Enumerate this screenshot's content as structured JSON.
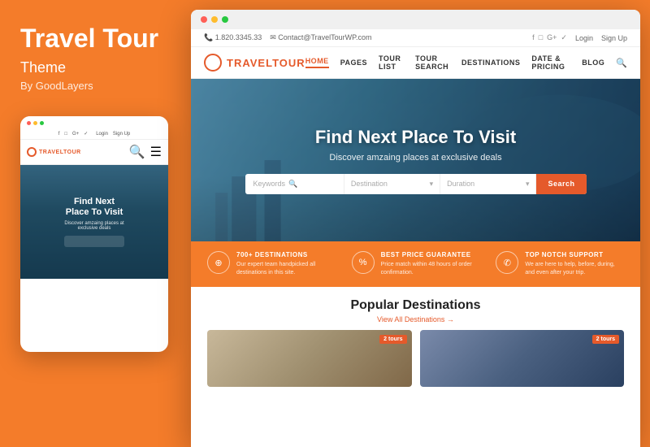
{
  "left": {
    "title": "Travel\nTour",
    "subtitle": "Theme",
    "by": "By GoodLayers"
  },
  "mobile": {
    "dots": [
      "red",
      "yellow",
      "green"
    ],
    "topLinks": [
      "f",
      "□",
      "G+",
      "✓"
    ],
    "loginLabel": "Login",
    "signUpLabel": "Sign Up",
    "logoText": "TRAVEL",
    "logoSpan": "TOUR",
    "heroTitle": "Find Next\nPlace To Visit",
    "heroSubtitle": "Discover amzaing places at\nexclusive deals"
  },
  "desktop": {
    "chromeDots": [
      "red",
      "yellow",
      "green"
    ],
    "topbar": {
      "phone": "📞 1.820.3345.33",
      "email": "✉ Contact@TravelTourWP.com",
      "social": [
        "f",
        "□",
        "G+",
        "✓"
      ],
      "login": "Login",
      "signup": "Sign Up"
    },
    "nav": {
      "logoText": "TRAVEL",
      "logoSpan": "TOUR",
      "menuItems": [
        "HOME",
        "PAGES",
        "TOUR LIST",
        "TOUR SEARCH",
        "DESTINATIONS",
        "DATE & PRICING",
        "BLOG"
      ]
    },
    "hero": {
      "title": "Find Next Place To Visit",
      "subtitle": "Discover amzaing places at exclusive deals",
      "search": {
        "keywordsPlaceholder": "Keywords",
        "destinationPlaceholder": "Destination",
        "durationPlaceholder": "Duration",
        "buttonLabel": "Search"
      }
    },
    "features": [
      {
        "icon": "⊕",
        "title": "700+ DESTINATIONS",
        "desc": "Our expert team handpicked all destinations in this site."
      },
      {
        "icon": "%",
        "title": "BEST PRICE GUARANTEE",
        "desc": "Price match within 48 hours of order confirmation."
      },
      {
        "icon": "✆",
        "title": "TOP NOTCH SUPPORT",
        "desc": "We are here to help, before, during, and even after your trip."
      }
    ],
    "popular": {
      "title": "Popular Destinations",
      "viewAll": "View All Destinations →",
      "cards": [
        {
          "badge": "2 tours"
        },
        {
          "badge": "2 tours"
        }
      ]
    }
  }
}
